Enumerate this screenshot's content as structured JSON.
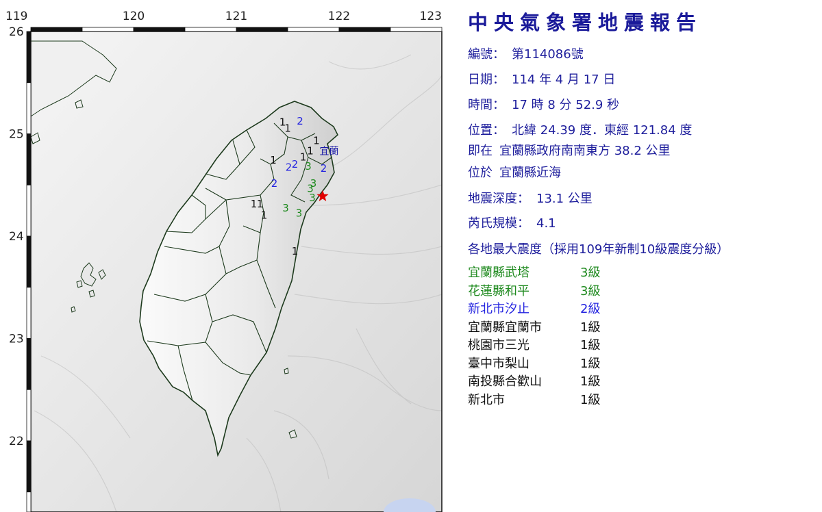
{
  "report": {
    "title": "中央氣象署地震報告",
    "number_label": "編號：",
    "number": "第114086號",
    "date_label": "日期：",
    "date": "114 年 4 月 17 日",
    "time_label": "時間：",
    "time": "17 時 8 分 52.9 秒",
    "position_label": "位置：",
    "position": "北緯 24.39 度．東經 121.84 度",
    "located_label": "即在",
    "located": "宜蘭縣政府南南東方 38.2 公里",
    "region_label": "位於",
    "region": "宜蘭縣近海",
    "depth_label": "地震深度：",
    "depth": "13.1 公里",
    "magnitude_label": "芮氏規模：",
    "magnitude": "4.1",
    "intensity_heading": "各地最大震度（採用109年新制10級震度分級）",
    "intensities": [
      {
        "location": "宜蘭縣武塔",
        "level": "3級",
        "color": "#1f8a1f"
      },
      {
        "location": "花蓮縣和平",
        "level": "3級",
        "color": "#1f8a1f"
      },
      {
        "location": "新北市汐止",
        "level": "2級",
        "color": "#2323e0"
      },
      {
        "location": "宜蘭縣宜蘭市",
        "level": "1級",
        "color": "#111111"
      },
      {
        "location": "桃園市三光",
        "level": "1級",
        "color": "#111111"
      },
      {
        "location": "臺中市梨山",
        "level": "1級",
        "color": "#111111"
      },
      {
        "location": "南投縣合歡山",
        "level": "1級",
        "color": "#111111"
      },
      {
        "location": "新北市",
        "level": "1級",
        "color": "#111111"
      }
    ]
  },
  "map": {
    "lon_ticks": [
      "119",
      "120",
      "121",
      "122",
      "123"
    ],
    "lat_ticks": [
      "26",
      "25",
      "24",
      "23",
      "22"
    ],
    "station_name": "宜蘭",
    "epicenter": {
      "lat": 24.39,
      "lon": 121.84,
      "color": "#e00000"
    },
    "station_marks": [
      {
        "value": "1",
        "lon": 121.45,
        "lat": 25.08,
        "color": "#111111"
      },
      {
        "value": "2",
        "lon": 121.62,
        "lat": 25.09,
        "color": "#2323e0"
      },
      {
        "value": "1",
        "lon": 121.5,
        "lat": 25.02,
        "color": "#111111"
      },
      {
        "value": "1",
        "lon": 121.78,
        "lat": 24.9,
        "color": "#111111"
      },
      {
        "value": "1",
        "lon": 121.72,
        "lat": 24.8,
        "color": "#111111"
      },
      {
        "value": "1",
        "lon": 121.65,
        "lat": 24.74,
        "color": "#111111"
      },
      {
        "value": "1",
        "lon": 121.36,
        "lat": 24.71,
        "color": "#111111"
      },
      {
        "value": "2",
        "lon": 121.51,
        "lat": 24.64,
        "color": "#2323e0"
      },
      {
        "value": "2",
        "lon": 121.57,
        "lat": 24.67,
        "color": "#2323e0"
      },
      {
        "value": "3",
        "lon": 121.7,
        "lat": 24.65,
        "color": "#1f8a1f"
      },
      {
        "value": "2",
        "lon": 121.85,
        "lat": 24.63,
        "color": "#2323e0"
      },
      {
        "value": "2",
        "lon": 121.37,
        "lat": 24.48,
        "color": "#2323e0"
      },
      {
        "value": "3",
        "lon": 121.75,
        "lat": 24.48,
        "color": "#1f8a1f"
      },
      {
        "value": "3",
        "lon": 121.72,
        "lat": 24.43,
        "color": "#1f8a1f"
      },
      {
        "value": "3",
        "lon": 121.74,
        "lat": 24.34,
        "color": "#1f8a1f"
      },
      {
        "value": "1",
        "lon": 121.17,
        "lat": 24.28,
        "color": "#111111"
      },
      {
        "value": "1",
        "lon": 121.23,
        "lat": 24.28,
        "color": "#111111"
      },
      {
        "value": "3",
        "lon": 121.48,
        "lat": 24.24,
        "color": "#1f8a1f"
      },
      {
        "value": "3",
        "lon": 121.61,
        "lat": 24.19,
        "color": "#1f8a1f"
      },
      {
        "value": "1",
        "lon": 121.27,
        "lat": 24.17,
        "color": "#111111"
      },
      {
        "value": "1",
        "lon": 121.57,
        "lat": 23.82,
        "color": "#111111"
      }
    ]
  }
}
